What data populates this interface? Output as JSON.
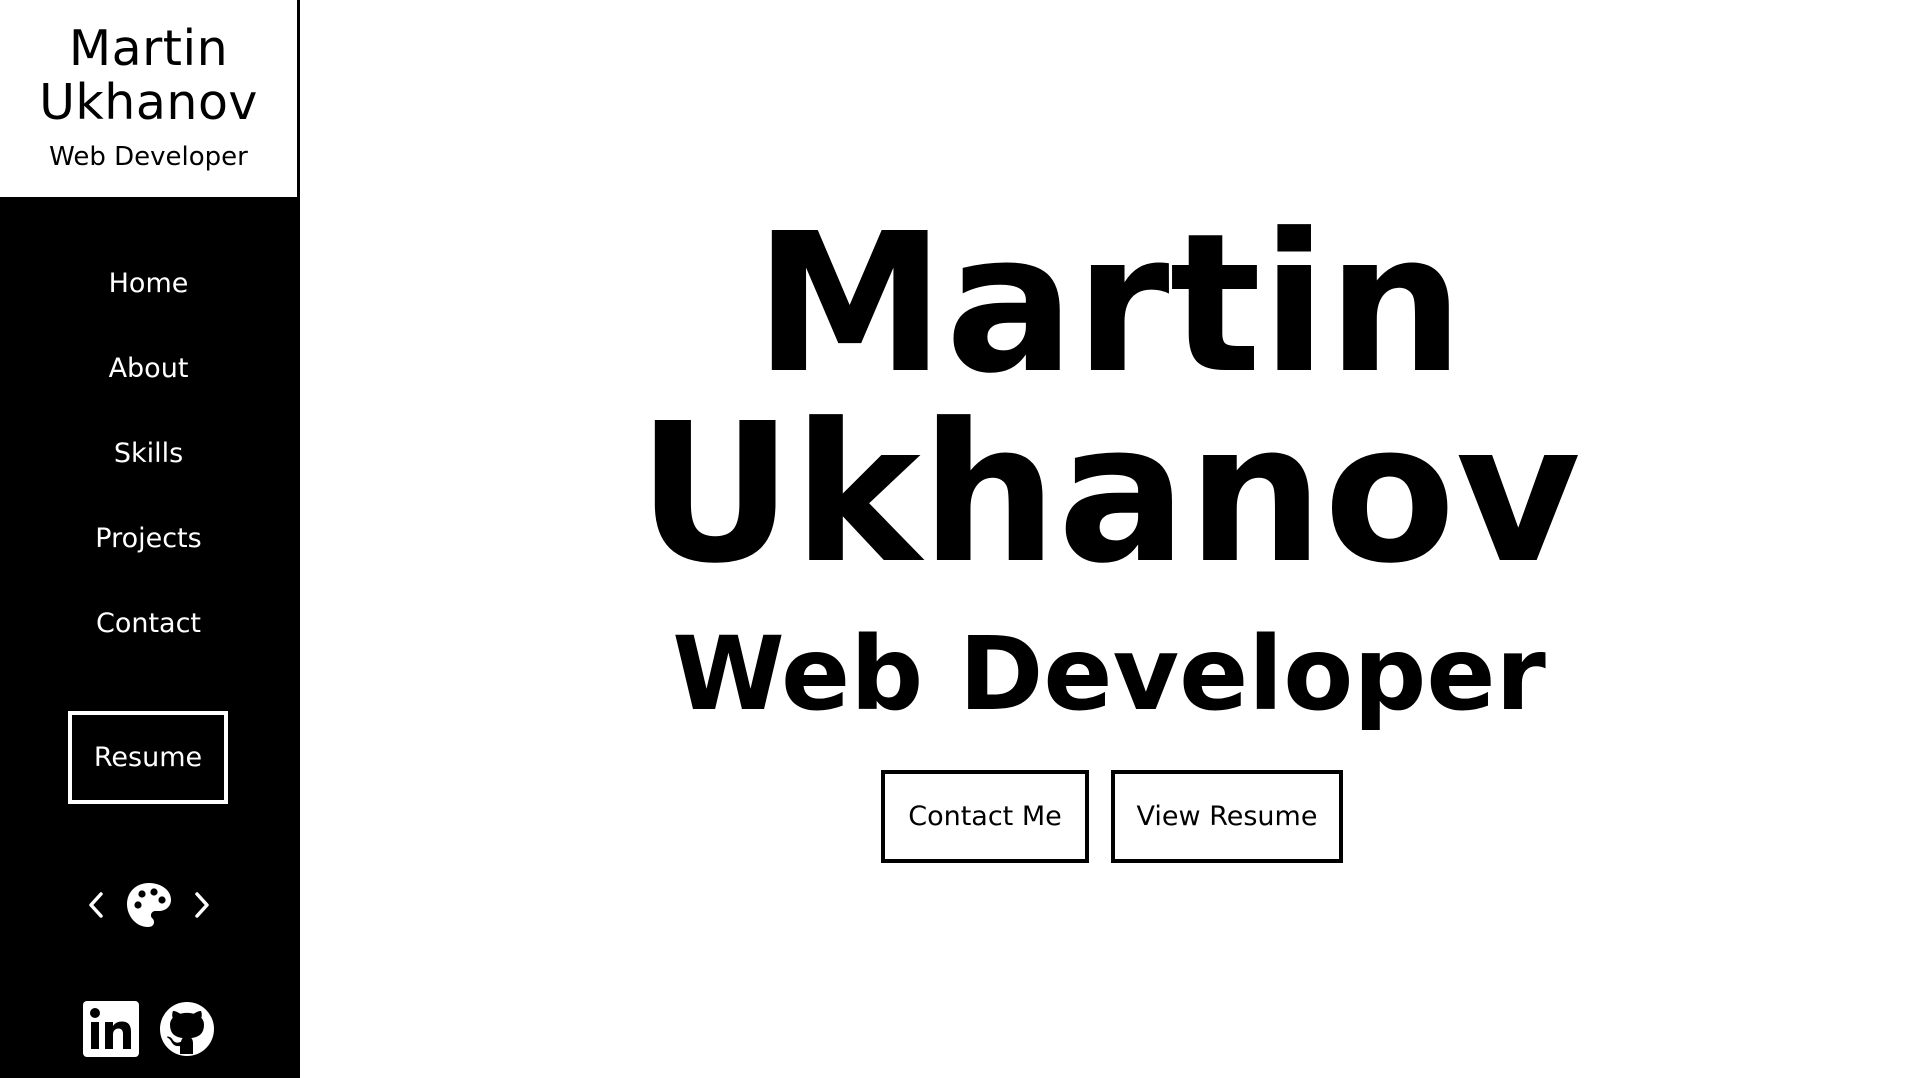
{
  "sidebar": {
    "brand": {
      "name": "Martin Ukhanov",
      "role": "Web Developer"
    },
    "nav": [
      {
        "label": "Home"
      },
      {
        "label": "About"
      },
      {
        "label": "Skills"
      },
      {
        "label": "Projects"
      },
      {
        "label": "Contact"
      }
    ],
    "resume_label": "Resume",
    "theme_switcher": {
      "prev_icon": "chevron-left-icon",
      "icon": "palette-icon",
      "next_icon": "chevron-right-icon"
    },
    "social": [
      {
        "icon": "linkedin-icon"
      },
      {
        "icon": "github-icon"
      }
    ]
  },
  "hero": {
    "name": "Martin Ukhanov",
    "role": "Web Developer",
    "buttons": {
      "contact": "Contact Me",
      "resume": "View Resume"
    }
  },
  "colors": {
    "background": "#ffffff",
    "sidebar": "#000000",
    "text": "#000000",
    "sidebar_text": "#ffffff"
  }
}
